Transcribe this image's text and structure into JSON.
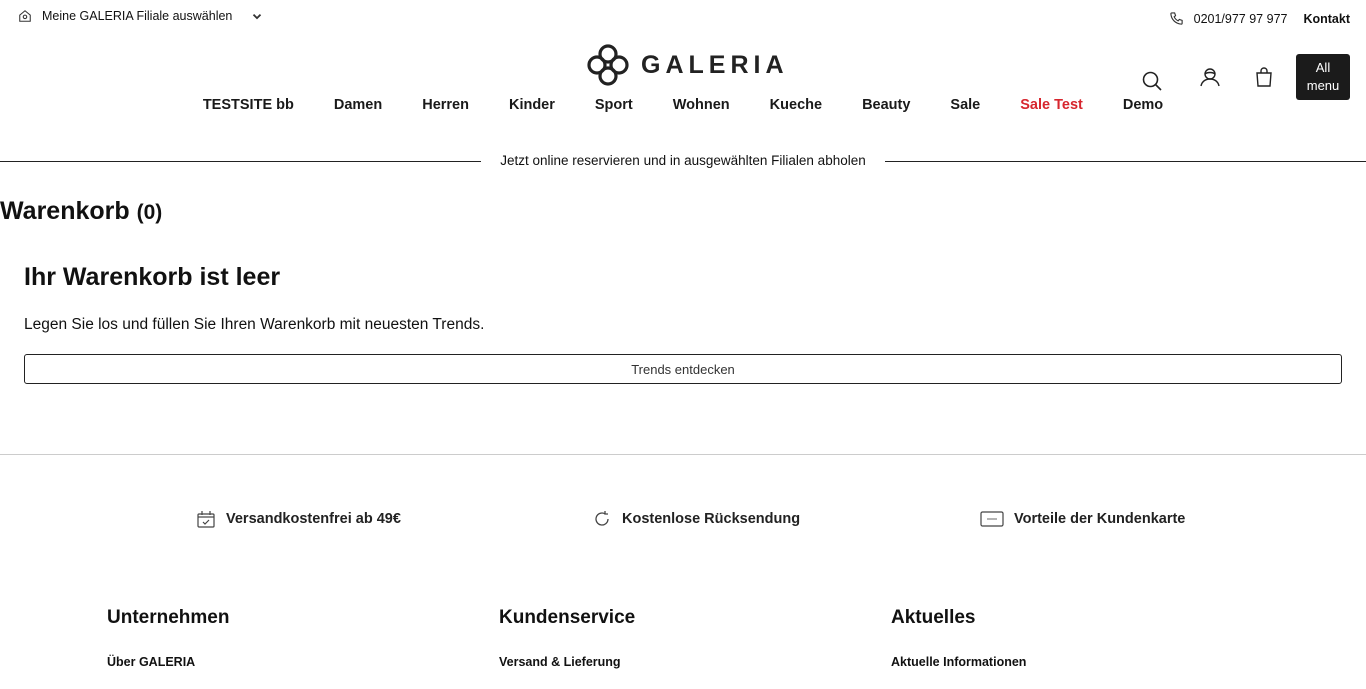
{
  "topbar": {
    "store_label": "Meine GALERIA Filiale auswählen",
    "phone": "0201/977 97 977",
    "contact": "Kontakt"
  },
  "logo": {
    "wordmark": "GALERIA"
  },
  "header": {
    "all_menu": "All menu"
  },
  "nav": {
    "items": [
      {
        "label": "TESTSITE bb"
      },
      {
        "label": "Damen"
      },
      {
        "label": "Herren"
      },
      {
        "label": "Kinder"
      },
      {
        "label": "Sport"
      },
      {
        "label": "Wohnen"
      },
      {
        "label": "Kueche"
      },
      {
        "label": "Beauty"
      },
      {
        "label": "Sale"
      },
      {
        "label": "Sale Test"
      },
      {
        "label": "Demo"
      }
    ],
    "highlight_color": "#d7262e"
  },
  "banner": {
    "text": "Jetzt online reservieren und in ausgewählten Filialen abholen"
  },
  "cart": {
    "title": "Warenkorb",
    "count": "(0)",
    "empty_heading": "Ihr Warenkorb ist leer",
    "empty_text": "Legen Sie los und füllen Sie Ihren Warenkorb mit neuesten Trends.",
    "cta": "Trends entdecken"
  },
  "usps": [
    {
      "label": "Versandkostenfrei ab 49€",
      "icon": "delivery-box-icon"
    },
    {
      "label": "Kostenlose Rücksendung",
      "icon": "return-arrow-icon"
    },
    {
      "label": "Vorteile der Kundenkarte",
      "icon": "customer-card-icon"
    }
  ],
  "footer": {
    "columns": [
      {
        "heading": "Unternehmen",
        "first_link": "Über GALERIA"
      },
      {
        "heading": "Kundenservice",
        "first_link": "Versand & Lieferung"
      },
      {
        "heading": "Aktuelles",
        "first_link": "Aktuelle Informationen"
      }
    ]
  }
}
